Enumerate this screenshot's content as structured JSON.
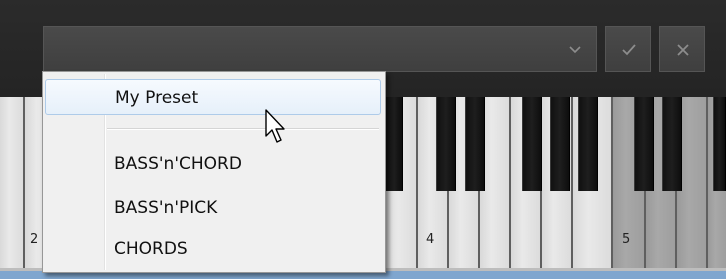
{
  "toolbar": {
    "preset_value": "",
    "dropdown_icon": "chevron-down-icon",
    "confirm_icon": "checkmark-icon",
    "close_icon": "close-icon"
  },
  "menu": {
    "items": [
      {
        "label": "My Preset",
        "state": "hover"
      },
      {
        "label": "BASS'n'CHORD"
      },
      {
        "label": "BASS'n'PICK"
      },
      {
        "label": "CHORDS"
      }
    ]
  },
  "keyboard": {
    "octave_labels": [
      "2",
      "4",
      "5"
    ]
  },
  "colors": {
    "accent": "#7fa6cf",
    "menu_bg": "#f0f0f0",
    "hover_border": "#aecbe9"
  }
}
